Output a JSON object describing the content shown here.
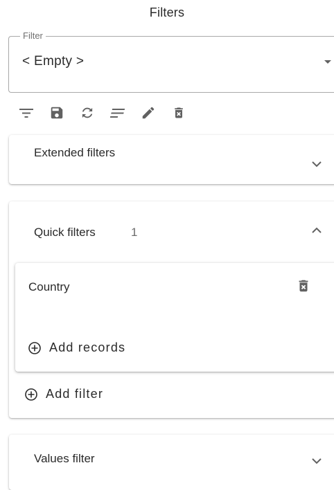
{
  "panel": {
    "title": "Filters"
  },
  "filter_select": {
    "label": "Filter",
    "value": "< Empty >"
  },
  "toolbar": {
    "icons": [
      "filter-list-icon",
      "save-icon",
      "refresh-icon",
      "format-align-icon",
      "edit-icon",
      "delete-icon"
    ]
  },
  "extended_filters": {
    "label": "Extended filters",
    "expanded": false
  },
  "quick_filters": {
    "label": "Quick filters",
    "count": "1",
    "expanded": true,
    "items": [
      {
        "name": "Country",
        "add_records_label": "Add records"
      }
    ],
    "add_filter_label": "Add filter"
  },
  "values_filter": {
    "label": "Values filter",
    "expanded": false
  },
  "colors": {
    "icon": "#616161",
    "text": "#2a2a2a",
    "border": "#a8a8a8"
  }
}
